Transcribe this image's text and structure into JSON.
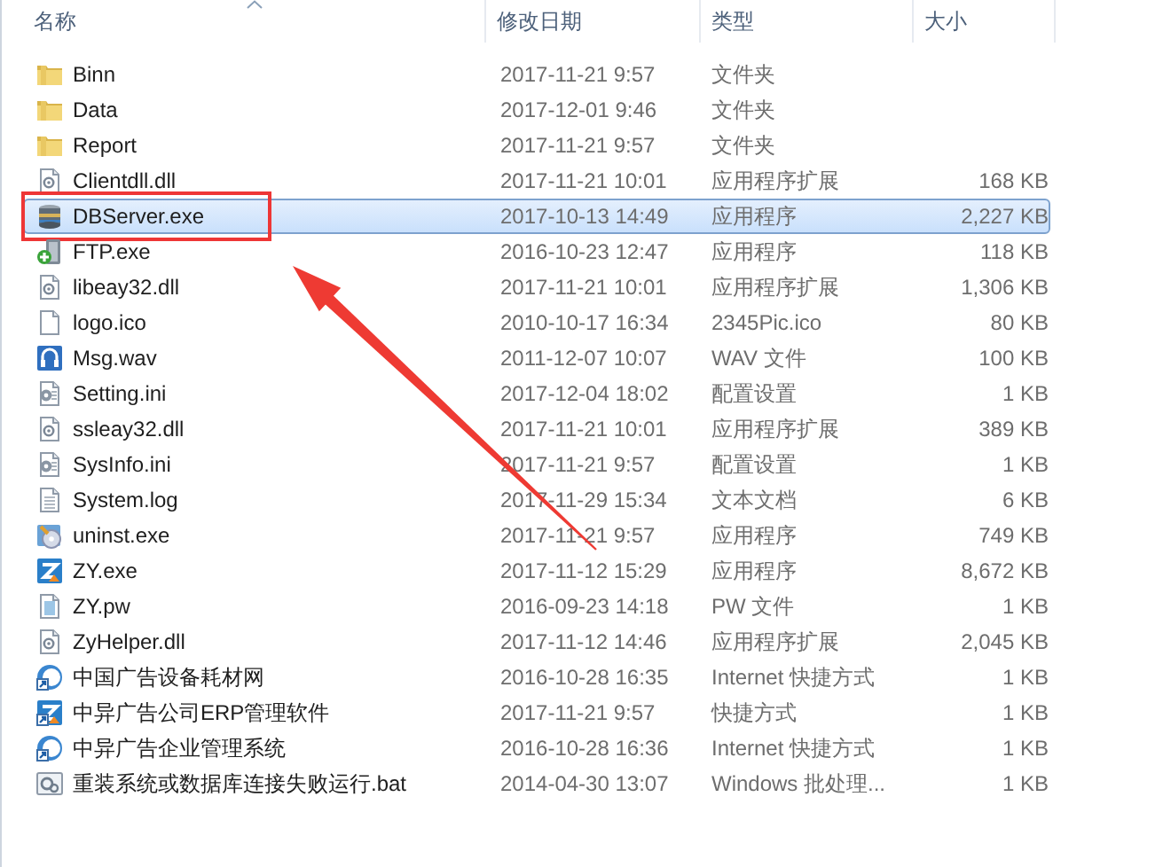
{
  "columns": [
    {
      "label": "名称",
      "sorted": true
    },
    {
      "label": "修改日期",
      "sorted": false
    },
    {
      "label": "类型",
      "sorted": false
    },
    {
      "label": "大小",
      "sorted": false
    }
  ],
  "rows": [
    {
      "kind": "folder",
      "name": "Binn",
      "date": "2017-11-21 9:57",
      "type": "文件夹",
      "selected": false,
      "annotated": false
    },
    {
      "kind": "folder",
      "name": "Data",
      "date": "2017-12-01 9:46",
      "type": "文件夹",
      "selected": false,
      "annotated": false
    },
    {
      "kind": "folder",
      "name": "Report",
      "date": "2017-11-21 9:57",
      "type": "文件夹",
      "selected": false,
      "annotated": false
    },
    {
      "kind": "dll",
      "name": "Clientdll.dll",
      "date": "2017-11-21 10:01",
      "type": "应用程序扩展",
      "size": "168 KB",
      "selected": false,
      "annotated": false
    },
    {
      "kind": "database",
      "name": "DBServer.exe",
      "date": "2017-10-13 14:49",
      "type": "应用程序",
      "size": "2,227 KB",
      "selected": true,
      "annotated": true
    },
    {
      "kind": "ftp",
      "name": "FTP.exe",
      "date": "2016-10-23 12:47",
      "type": "应用程序",
      "size": "118 KB",
      "selected": false,
      "annotated": false
    },
    {
      "kind": "dll",
      "name": "libeay32.dll",
      "date": "2017-11-21 10:01",
      "type": "应用程序扩展",
      "size": "1,306 KB",
      "selected": false,
      "annotated": false
    },
    {
      "kind": "blank",
      "name": "logo.ico",
      "date": "2010-10-17 16:34",
      "type": "2345Pic.ico",
      "size": "80 KB",
      "selected": false,
      "annotated": false
    },
    {
      "kind": "audio",
      "name": "Msg.wav",
      "date": "2011-12-07 10:07",
      "type": "WAV 文件",
      "size": "100 KB",
      "selected": false,
      "annotated": false
    },
    {
      "kind": "config",
      "name": "Setting.ini",
      "date": "2017-12-04 18:02",
      "type": "配置设置",
      "size": "1 KB",
      "selected": false,
      "annotated": false
    },
    {
      "kind": "dll",
      "name": "ssleay32.dll",
      "date": "2017-11-21 10:01",
      "type": "应用程序扩展",
      "size": "389 KB",
      "selected": false,
      "annotated": false
    },
    {
      "kind": "config",
      "name": "SysInfo.ini",
      "date": "2017-11-21 9:57",
      "type": "配置设置",
      "size": "1 KB",
      "selected": false,
      "annotated": false
    },
    {
      "kind": "text",
      "name": "System.log",
      "date": "2017-11-29 15:34",
      "type": "文本文档",
      "size": "6 KB",
      "selected": false,
      "annotated": false
    },
    {
      "kind": "installer",
      "name": "uninst.exe",
      "date": "2017-11-21 9:57",
      "type": "应用程序",
      "size": "749 KB",
      "selected": false,
      "annotated": false
    },
    {
      "kind": "app",
      "name": "ZY.exe",
      "date": "2017-11-12 15:29",
      "type": "应用程序",
      "size": "8,672 KB",
      "selected": false,
      "annotated": false
    },
    {
      "kind": "generic",
      "name": "ZY.pw",
      "date": "2016-09-23 14:18",
      "type": "PW 文件",
      "size": "1 KB",
      "selected": false,
      "annotated": false
    },
    {
      "kind": "dll",
      "name": "ZyHelper.dll",
      "date": "2017-11-12 14:46",
      "type": "应用程序扩展",
      "size": "2,045 KB",
      "selected": false,
      "annotated": false
    },
    {
      "kind": "weblink",
      "name": "中国广告设备耗材网",
      "date": "2016-10-28 16:35",
      "type": "Internet 快捷方式",
      "size": "1 KB",
      "selected": false,
      "annotated": false
    },
    {
      "kind": "applink",
      "name": "中异广告公司ERP管理软件",
      "date": "2017-11-21 9:57",
      "type": "快捷方式",
      "size": "1 KB",
      "selected": false,
      "annotated": false
    },
    {
      "kind": "weblink",
      "name": "中异广告企业管理系统",
      "date": "2016-10-28 16:36",
      "type": "Internet 快捷方式",
      "size": "1 KB",
      "selected": false,
      "annotated": false
    },
    {
      "kind": "batch",
      "name": "重装系统或数据库连接失败运行.bat",
      "date": "2014-04-30 13:07",
      "type": "Windows 批处理...",
      "size": "1 KB",
      "selected": false,
      "annotated": false
    }
  ]
}
